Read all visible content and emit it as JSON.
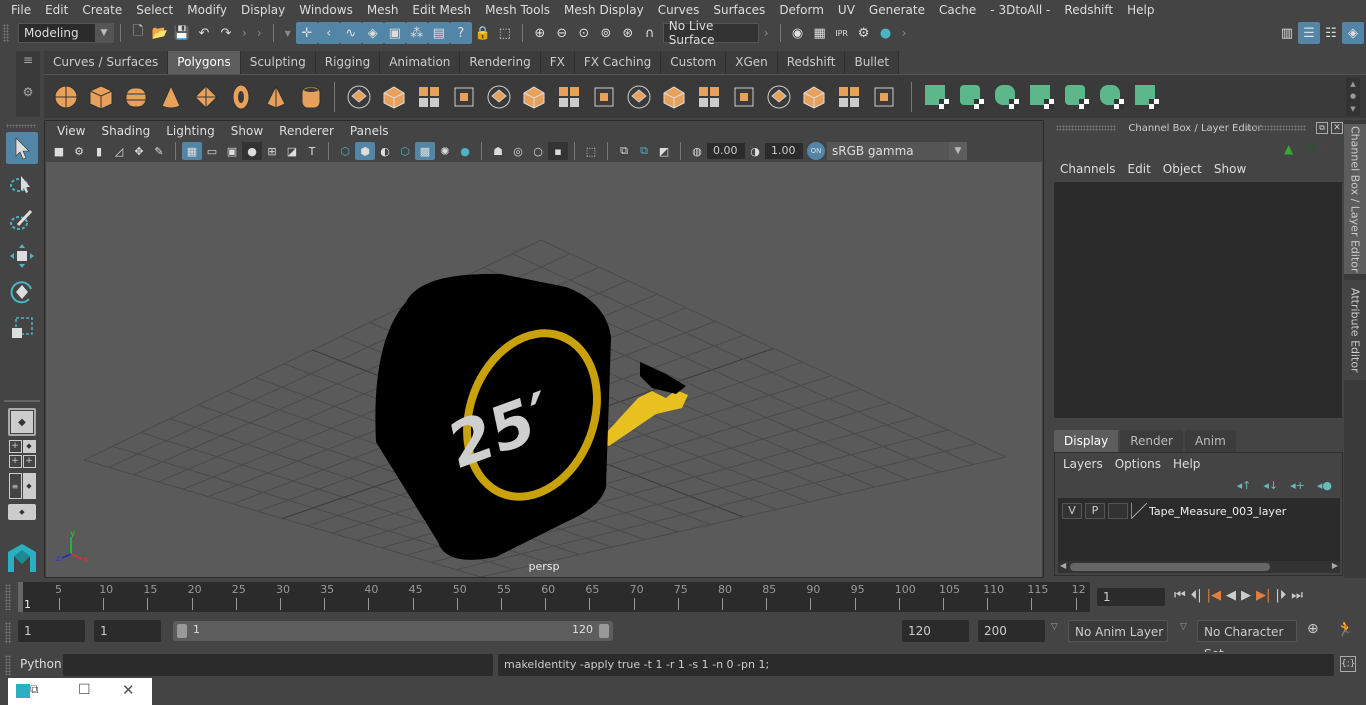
{
  "menubar": {
    "items": [
      "File",
      "Edit",
      "Create",
      "Select",
      "Modify",
      "Display",
      "Windows",
      "Mesh",
      "Edit Mesh",
      "Mesh Tools",
      "Mesh Display",
      "Curves",
      "Surfaces",
      "Deform",
      "UV",
      "Generate",
      "Cache",
      "- 3DtoAll -",
      "Redshift",
      "Help"
    ]
  },
  "statusline": {
    "mode": "Modeling",
    "live_surface": "No Live Surface",
    "icons": [
      "new-scene",
      "open-scene",
      "save-scene",
      "undo",
      "redo",
      "select-hierarchy",
      "select-object",
      "select-component",
      "snap-grid",
      "snap-curve",
      "snap-point",
      "snap-view-plane",
      "snap-live",
      "render-view",
      "render-current",
      "ipr-render",
      "render-settings",
      "hypershade"
    ]
  },
  "shelf": {
    "tabs": [
      "Curves / Surfaces",
      "Polygons",
      "Sculpting",
      "Rigging",
      "Animation",
      "Rendering",
      "FX",
      "FX Caching",
      "Custom",
      "XGen",
      "Redshift",
      "Bullet"
    ],
    "active_tab": "Polygons",
    "orange_icons": [
      "poly-sphere",
      "poly-cube",
      "poly-cylinder",
      "poly-cone",
      "poly-plane",
      "poly-torus",
      "poly-pyramid",
      "poly-pipe"
    ],
    "tool_icons": [
      "combine",
      "separate",
      "mirror",
      "smooth",
      "extract",
      "boolean",
      "bevel",
      "bridge",
      "extrude",
      "multi-cut",
      "insert-edge-loop",
      "offset-edge-loop",
      "append-polygon",
      "fill-hole",
      "target-weld",
      "merge"
    ],
    "uv_icons": [
      "planar-map",
      "cylindrical-map",
      "spherical-map",
      "automatic-map",
      "contour-stretch",
      "uv-editor",
      "unfold"
    ]
  },
  "toolbox": {
    "tools": [
      "select-tool",
      "lasso-tool",
      "paint-select-tool",
      "move-tool",
      "rotate-tool",
      "scale-tool"
    ],
    "layouts": [
      "single-pane",
      "four-pane",
      "outliner-persp",
      "persp-graph"
    ]
  },
  "viewport": {
    "menu": [
      "View",
      "Shading",
      "Lighting",
      "Show",
      "Renderer",
      "Panels"
    ],
    "exposure": "0.00",
    "gamma": "1.00",
    "color_space": "sRGB gamma",
    "camera_label": "persp",
    "model_label": "25′"
  },
  "channel_box": {
    "title": "Channel Box / Layer Editor",
    "menu": [
      "Channels",
      "Edit",
      "Object",
      "Show"
    ]
  },
  "layer_editor": {
    "tabs": [
      "Display",
      "Render",
      "Anim"
    ],
    "active_tab": "Display",
    "menu": [
      "Layers",
      "Options",
      "Help"
    ],
    "layers": [
      {
        "v": "V",
        "p": "P",
        "name": "Tape_Measure_003_layer"
      }
    ]
  },
  "side_tabs": [
    "Channel Box / Layer Editor",
    "Attribute Editor"
  ],
  "timeline": {
    "ticks": [
      "5",
      "10",
      "15",
      "20",
      "25",
      "30",
      "35",
      "40",
      "45",
      "50",
      "55",
      "60",
      "65",
      "70",
      "75",
      "80",
      "85",
      "90",
      "95",
      "100",
      "105",
      "110",
      "115",
      "12"
    ],
    "current_frame_marker": "1",
    "current_frame": "1"
  },
  "range": {
    "start": "1",
    "playback_start": "1",
    "slider_start": "1",
    "slider_end": "120",
    "playback_end": "120",
    "end": "200",
    "anim_layer": "No Anim Layer",
    "character_set": "No Character Set"
  },
  "command_line": {
    "language": "Python",
    "input": "",
    "result": "makeIdentity -apply true -t 1 -r 1 -s 1 -n 0 -pn 1;"
  },
  "colors": {
    "accent_blue": "#5285a6",
    "shelf_orange": "#e8a15a",
    "uv_green": "#5cb88a",
    "viewport_bg": "#5a5a5a"
  }
}
